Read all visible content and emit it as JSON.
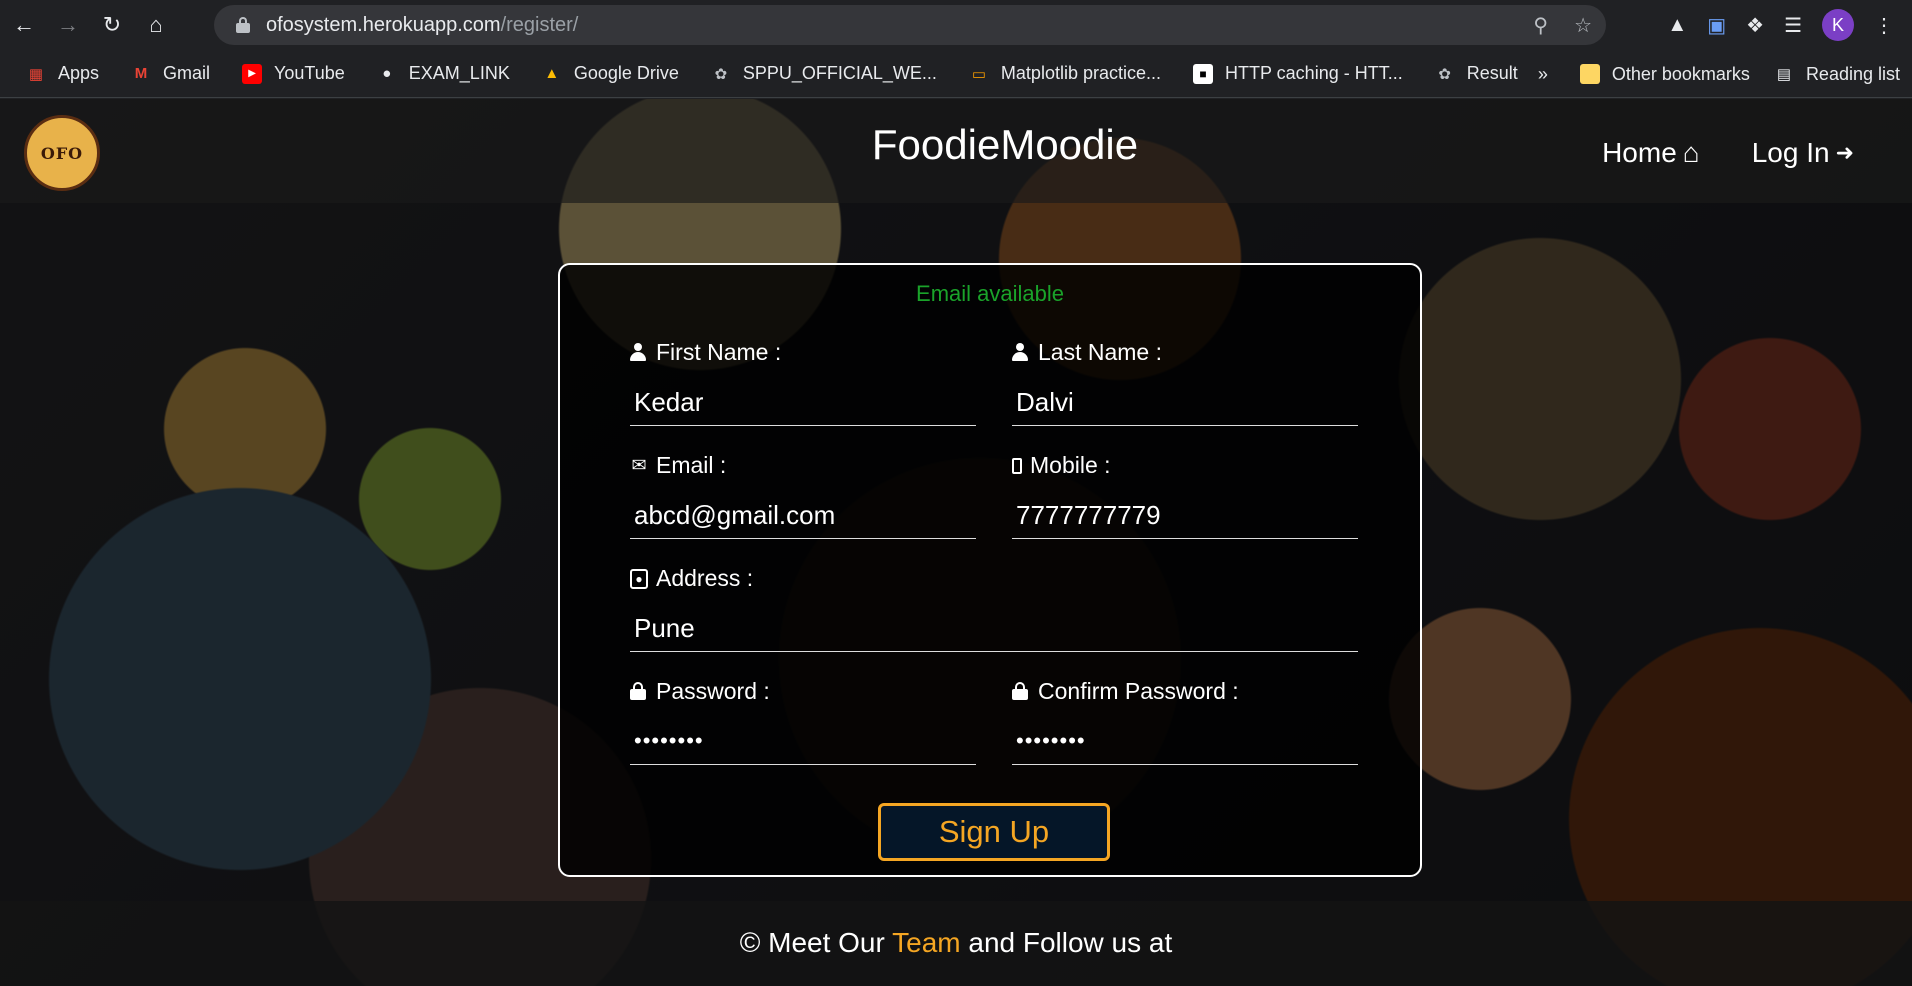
{
  "browser": {
    "url_host": "ofosystem.herokuapp.com",
    "url_path": "/register/",
    "profile_initial": "K",
    "bookmarks": [
      "Apps",
      "Gmail",
      "YouTube",
      "EXAM_LINK",
      "Google Drive",
      "SPPU_OFFICIAL_WE...",
      "Matplotlib practice...",
      "HTTP caching - HTT...",
      "Result"
    ],
    "more_bookmarks": "»",
    "other_bookmarks": "Other bookmarks",
    "reading_list": "Reading list"
  },
  "header": {
    "logo_text": "OFO",
    "brand": "FoodieMoodie",
    "nav_home": "Home",
    "nav_login": "Log In"
  },
  "form": {
    "status": "Email available",
    "first_name_label": "First Name :",
    "first_name_value": "Kedar",
    "last_name_label": "Last Name :",
    "last_name_value": "Dalvi",
    "email_label": "Email :",
    "email_value": "abcd@gmail.com",
    "mobile_label": "Mobile :",
    "mobile_value": "7777777779",
    "address_label": "Address :",
    "address_value": "Pune",
    "password_label": "Password :",
    "password_value": "••••••••",
    "confirm_label": "Confirm Password :",
    "confirm_value": "••••••••",
    "signup_label": "Sign Up"
  },
  "footer": {
    "prefix": "© Meet Our",
    "team": "Team",
    "suffix": "and Follow us at"
  },
  "colors": {
    "status_green": "#1aa32a",
    "accent_orange": "#f5a623"
  }
}
